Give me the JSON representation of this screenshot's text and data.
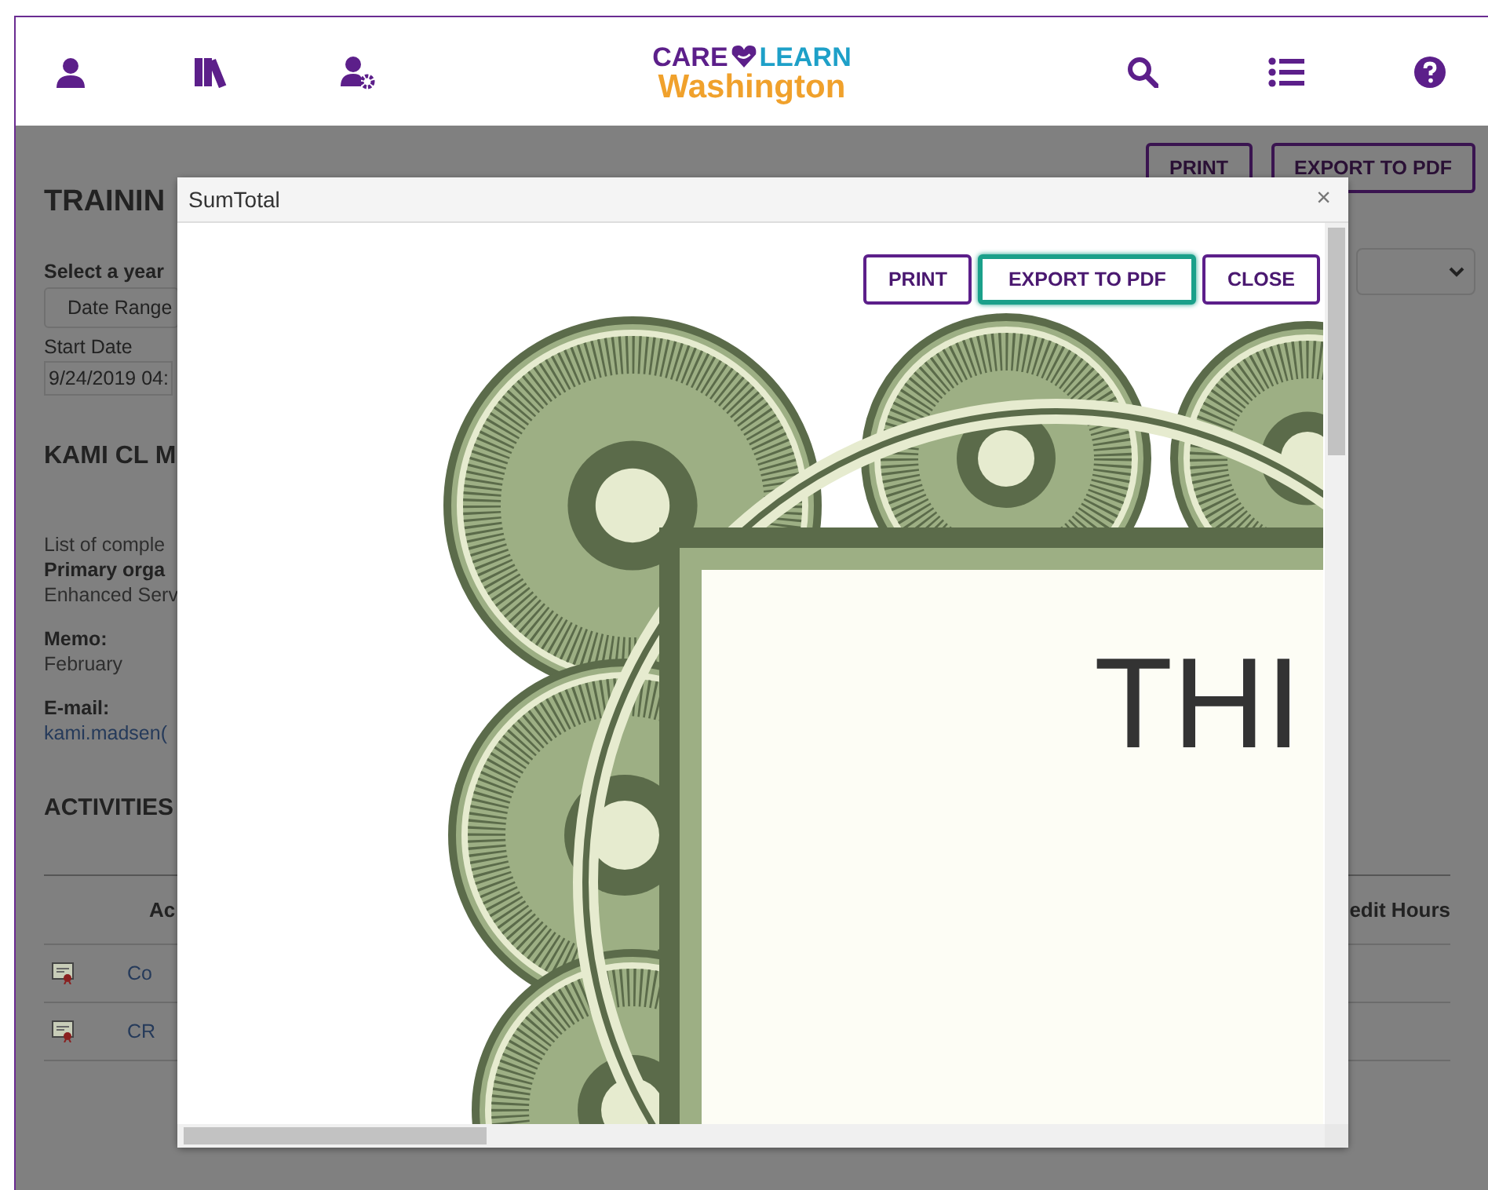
{
  "header": {
    "logo": {
      "word_1": "CARE",
      "word_2": "LEARN",
      "word_3": "Washington"
    }
  },
  "page": {
    "title": "TRAININ",
    "buttons": [
      "PRINT",
      "EXPORT TO PDF"
    ],
    "year_filter": {
      "label": "Select a year",
      "value": "Date Range"
    },
    "start_date": {
      "label": "Start Date",
      "value": "9/24/2019 04:"
    },
    "person_name": "KAMI CL M",
    "details": [
      {
        "kind": "plain",
        "text": "List of comple"
      },
      {
        "kind": "bold",
        "text": "Primary orga"
      },
      {
        "kind": "plain",
        "text": "Enhanced Serv"
      }
    ],
    "memo": {
      "label": "Memo:",
      "value": "February"
    },
    "email": {
      "label": "E-mail:",
      "value": "kami.madsen("
    },
    "section_title": "ACTIVITIES",
    "table": {
      "columns": [
        "Ac",
        "edit Hours"
      ],
      "rows": [
        {
          "cell": "Co"
        },
        {
          "cell": "CR"
        }
      ]
    }
  },
  "modal": {
    "title": "SumTotal",
    "close": "×",
    "buttons": [
      {
        "label": "PRINT",
        "focused": false
      },
      {
        "label": "EXPORT TO PDF",
        "focused": true
      },
      {
        "label": "CLOSE",
        "focused": false
      }
    ],
    "certificate": {
      "heading": "THI"
    }
  }
}
